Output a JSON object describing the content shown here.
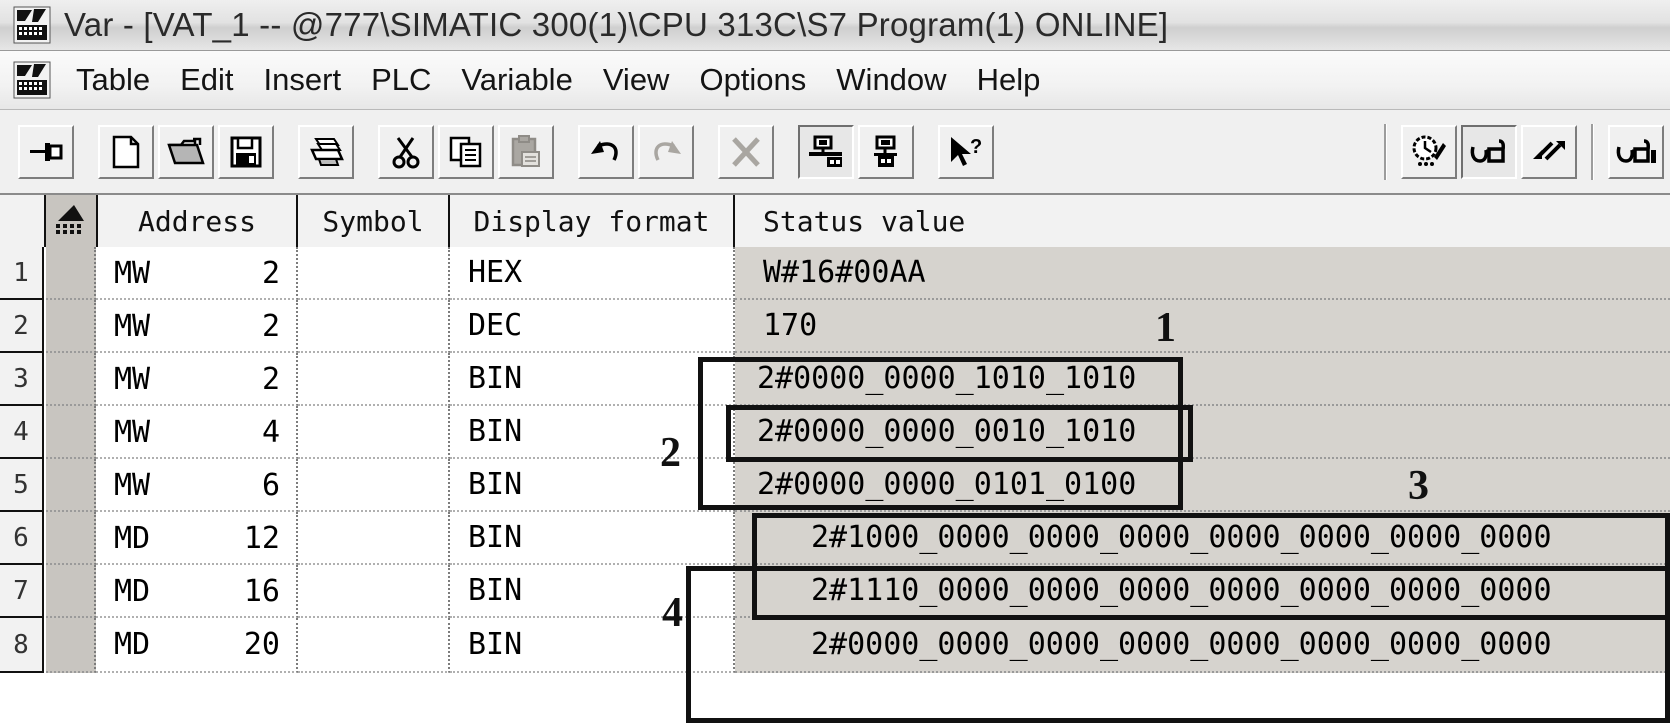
{
  "window": {
    "title": "Var - [VAT_1 -- @777\\SIMATIC 300(1)\\CPU 313C\\S7 Program(1)  ONLINE]",
    "app_icon": "simatic-var-table-icon"
  },
  "menubar": {
    "icon": "simatic-var-table-icon",
    "items": [
      {
        "label": "Table"
      },
      {
        "label": "Edit"
      },
      {
        "label": "Insert"
      },
      {
        "label": "PLC"
      },
      {
        "label": "Variable"
      },
      {
        "label": "View"
      },
      {
        "label": "Options"
      },
      {
        "label": "Window"
      },
      {
        "label": "Help"
      }
    ]
  },
  "toolbar": {
    "buttons": [
      {
        "name": "pin-window-button",
        "icon": "pin-icon",
        "state": "normal"
      },
      {
        "name": "new-button",
        "icon": "new-document-icon",
        "state": "normal"
      },
      {
        "name": "open-button",
        "icon": "open-folder-icon",
        "state": "normal"
      },
      {
        "name": "save-button",
        "icon": "floppy-save-icon",
        "state": "normal"
      },
      {
        "name": "print-button",
        "icon": "printer-icon",
        "state": "normal"
      },
      {
        "name": "cut-button",
        "icon": "scissors-icon",
        "state": "normal"
      },
      {
        "name": "copy-button",
        "icon": "copy-icon",
        "state": "normal"
      },
      {
        "name": "paste-button",
        "icon": "clipboard-paste-icon",
        "state": "disabled"
      },
      {
        "name": "undo-button",
        "icon": "undo-arrow-icon",
        "state": "normal"
      },
      {
        "name": "redo-button",
        "icon": "redo-arrow-icon",
        "state": "disabled"
      },
      {
        "name": "delete-button",
        "icon": "x-cross-icon",
        "state": "disabled"
      },
      {
        "name": "connect-online-button",
        "icon": "plc-online-icon",
        "state": "pressed"
      },
      {
        "name": "plc-link-button",
        "icon": "plc-link-icon",
        "state": "normal"
      },
      {
        "name": "context-help-button",
        "icon": "arrow-question-help-icon",
        "state": "normal"
      },
      {
        "name": "trigger-button",
        "icon": "clock-pencil-icon",
        "state": "normal"
      },
      {
        "name": "monitor-variable-button",
        "icon": "glasses-icon",
        "state": "pressed"
      },
      {
        "name": "modify-variable-button",
        "icon": "two-arrows-icon",
        "state": "normal"
      },
      {
        "name": "monitor-once-button",
        "icon": "glasses-bar-icon",
        "state": "normal"
      }
    ]
  },
  "table": {
    "columns": [
      {
        "key": "rownum",
        "label": ""
      },
      {
        "key": "mark",
        "label": "",
        "icon": "sort-mark-icon"
      },
      {
        "key": "address",
        "label": "Address"
      },
      {
        "key": "symbol",
        "label": "Symbol"
      },
      {
        "key": "format",
        "label": "Display format"
      },
      {
        "key": "status",
        "label": "Status value"
      }
    ],
    "rows": [
      {
        "n": "1",
        "operand": "MW",
        "offset": "2",
        "symbol": "",
        "format": "HEX",
        "status": "W#16#00AA"
      },
      {
        "n": "2",
        "operand": "MW",
        "offset": "2",
        "symbol": "",
        "format": "DEC",
        "status": "170"
      },
      {
        "n": "3",
        "operand": "MW",
        "offset": "2",
        "symbol": "",
        "format": "BIN",
        "status": "2#0000_0000_1010_1010"
      },
      {
        "n": "4",
        "operand": "MW",
        "offset": "4",
        "symbol": "",
        "format": "BIN",
        "status": "2#0000_0000_0010_1010"
      },
      {
        "n": "5",
        "operand": "MW",
        "offset": "6",
        "symbol": "",
        "format": "BIN",
        "status": "2#0000_0000_0101_0100"
      },
      {
        "n": "6",
        "operand": "MD",
        "offset": "12",
        "symbol": "",
        "format": "BIN",
        "status": "2#1000_0000_0000_0000_0000_0000_0000_0000"
      },
      {
        "n": "7",
        "operand": "MD",
        "offset": "16",
        "symbol": "",
        "format": "BIN",
        "status": "2#1110_0000_0000_0000_0000_0000_0000_0000"
      },
      {
        "n": "8",
        "operand": "MD",
        "offset": "20",
        "symbol": "",
        "format": "BIN",
        "status": "2#0000_0000_0000_0000_0000_0000_0000_0000"
      }
    ]
  },
  "annotations": [
    {
      "label": "1",
      "target": "status-row-4-callout"
    },
    {
      "label": "2",
      "target": "status-rows-3-5-callout"
    },
    {
      "label": "3",
      "target": "status-rows-6-7-callout"
    },
    {
      "label": "4",
      "target": "status-rows-6-8-callout"
    }
  ],
  "colors": {
    "window_bg": "#d6d3ce",
    "grid_bg": "#ffffff",
    "status_cell_bg": "#d6d3ce",
    "header_bg": "#f2f2f2",
    "annotation_stroke": "#111111"
  }
}
